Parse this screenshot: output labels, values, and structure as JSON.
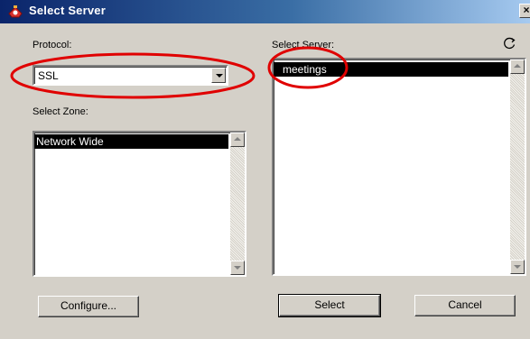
{
  "window": {
    "title": "Select Server",
    "close_glyph": "×",
    "accent_color": "#0a246a",
    "icons": [
      "app-icon",
      "close-icon",
      "refresh-icon"
    ]
  },
  "protocol": {
    "label": "Protocol:",
    "selected": "SSL"
  },
  "zone": {
    "label": "Select Zone:",
    "items": [
      "Network Wide"
    ]
  },
  "server": {
    "label": "Select Server:",
    "items": [
      "meetings"
    ]
  },
  "buttons": {
    "configure": "Configure...",
    "select": "Select",
    "cancel": "Cancel"
  },
  "annotations": {
    "color": "#e00000"
  }
}
